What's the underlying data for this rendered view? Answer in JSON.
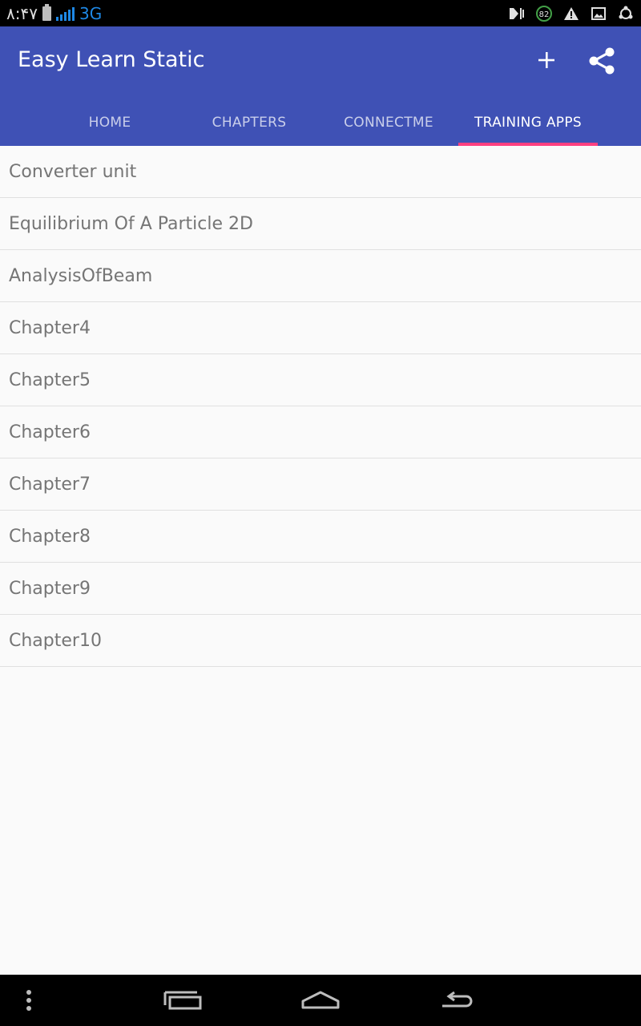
{
  "status_bar": {
    "time": "٨:۴٧",
    "network": "3G",
    "notification_count": "82",
    "icons": [
      "battery-icon",
      "signal-icon",
      "media-icon",
      "notification-badge-icon",
      "warning-icon",
      "image-icon",
      "sync-icon"
    ]
  },
  "app_bar": {
    "title": "Easy Learn Static",
    "actions": [
      "add-icon",
      "share-icon"
    ],
    "color": "#3f51b5",
    "indicator_color": "#ff4081"
  },
  "tabs": [
    {
      "label": "HOME",
      "active": false
    },
    {
      "label": "CHAPTERS",
      "active": false
    },
    {
      "label": "CONNECTME",
      "active": false
    },
    {
      "label": "TRAINING APPS",
      "active": true
    }
  ],
  "list": {
    "items": [
      "Converter unit",
      "Equilibrium Of A Particle 2D",
      "AnalysisOfBeam",
      "Chapter4",
      "Chapter5",
      "Chapter6",
      "Chapter7",
      "Chapter8",
      "Chapter9",
      "Chapter10"
    ]
  },
  "nav_bar": {
    "buttons": [
      "menu-dots-icon",
      "recent-apps-icon",
      "home-icon",
      "back-icon"
    ]
  }
}
